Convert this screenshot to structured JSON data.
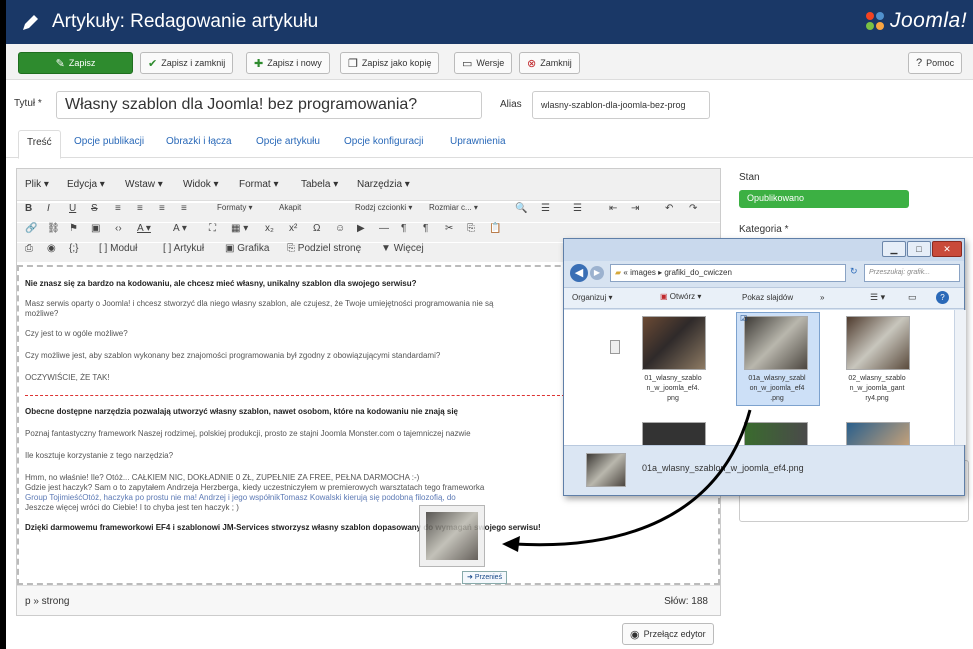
{
  "header": {
    "title": "Artykuły: Redagowanie artykułu",
    "logo_text": "Joomla!",
    "bg_color": "#1a3867"
  },
  "toolbar": {
    "save": "Zapisz",
    "save_close": "Zapisz i zamknij",
    "save_new": "Zapisz i nowy",
    "save_copy": "Zapisz jako kopię",
    "versions": "Wersje",
    "close": "Zamknij",
    "help": "Pomoc"
  },
  "form": {
    "title_label": "Tytuł *",
    "title_value": "Własny szablon dla Joomla! bez programowania?",
    "alias_label": "Alias",
    "alias_value": "wlasny-szablon-dla-joomla-bez-prog"
  },
  "tabs": [
    "Treść",
    "Opcje publikacji",
    "Obrazki i łącza",
    "Opcje artykułu",
    "Opcje konfiguracji",
    "Uprawnienia"
  ],
  "editor": {
    "menu": [
      "Plik ▾",
      "Edycja ▾",
      "Wstaw ▾",
      "Widok ▾",
      "Format ▾",
      "Tabela ▾",
      "Narzędzia ▾"
    ],
    "formats": "Formaty ▾",
    "paragraph": "Akapit",
    "font_family": "Rodzj czcionki ▾",
    "font_size": "Rozmiar c... ▾",
    "buttons": {
      "module": "Moduł",
      "article": "Artykuł",
      "image": "Grafika",
      "pagebreak": "Podziel stronę",
      "readmore": "Więcej"
    },
    "paragraphs": [
      "Nie znasz się za bardzo na kodowaniu, ale chcesz mieć własny, unikalny szablon dla swojego serwisu?",
      "Masz serwis oparty o Joomla! i chcesz stworzyć dla niego własny szablon, ale czujesz, że Twoje umiejętności programowania nie są",
      "możliwe?",
      "Czy jest to w ogóle możliwe?",
      "Czy możliwe jest, aby szablon wykonany bez znajomości programowania był zgodny z obowiązującymi standardami?",
      "OCZYWIŚCIE, ŻE TAK!",
      "Obecne dostępne narzędzia pozwalają utworzyć własny szablon, nawet osobom, które na kodowaniu nie znają się",
      "Poznaj fantastyczny framework Naszej rodzimej, polskiej produkcji, prosto ze stajni Joomla Monster.com o tajemniczej nazwie",
      "Ile kosztuje korzystanie z tego narzędzia?",
      "Hmm, no właśnie! Ile? Otóż... CAŁKIEM NIC, DOKŁADNIE 0 ZŁ, ZUPEŁNIE ZA FREE, PEŁNA DARMOCHA :-)",
      "Gdzie jest haczyk? Sam o to zapytałem Andrzeja Herzberga, kiedy uczestniczyłem w premierowych warsztatach tego frameworka",
      "Group TojimieśćOtóż, haczyka po prostu nie ma! Andrzej i jego współnikTomasz Kowalski kierują się podobną filozofią, do",
      "Jeszcze więcej wróci do Ciebie! I to chyba jest ten haczyk ; )",
      "Dzięki darmowemu frameworkowi EF4 i szablonowi JM-Services stworzysz własny szablon dopasowany do wymagań swojego serwisu!"
    ],
    "path": "p » strong",
    "word_count": "Słów: 188"
  },
  "sidebar": {
    "status_label": "Stan",
    "status_value": "Opublikowano",
    "category_label": "Kategoria *"
  },
  "toggle_editor": "Przełącz edytor",
  "explorer": {
    "path_parent": "« images",
    "path_current": "grafiki_do_cwiczen",
    "search_placeholder": "Przeszukaj: grafik...",
    "organize": "Organizuj ▾",
    "open": "Otwórz ▾",
    "slideshow": "Pokaz slajdów",
    "more": "»",
    "files": [
      {
        "name": "01_wlasny_szablon_w_joomla_ef4.png",
        "display": "01_wlasny_szablo\nn_w_joomla_ef4.\npng",
        "selected": false
      },
      {
        "name": "01a_wlasny_szablon_w_joomla_ef4.png",
        "display": "01a_wlasny_szabl\non_w_joomla_ef4\n.png",
        "selected": true
      },
      {
        "name": "02_wlasny_szablon_w_joomla_gantry4.png",
        "display": "02_wlasny_szablo\nn_w_joomla_gant\nry4.png",
        "selected": false
      }
    ],
    "details_filename": "01a_wlasny_szablon_w_joomla_ef4.png"
  },
  "drag": {
    "tooltip": "Przenieś"
  }
}
